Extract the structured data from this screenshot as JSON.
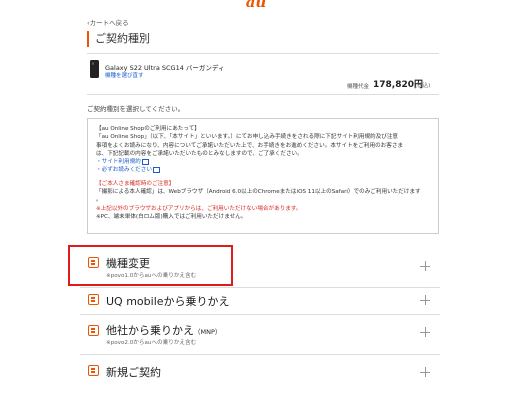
{
  "header": {
    "logo": "au"
  },
  "nav": {
    "back_label": "‹カートへ戻る"
  },
  "section": {
    "title": "ご契約種別"
  },
  "product": {
    "name": "Galaxy S22 Ultra SCG14 バーガンディ",
    "change_link": "機種を選び直す",
    "price_label": "機種代金",
    "price": "178,820円",
    "tax_note": "(税込)"
  },
  "instruction": "ご契約種別を選択してください。",
  "notice": {
    "l1": "【au Online Shopのご利用にあたって】",
    "l2": "「au Online Shop」（以下、「本サイト」といいます。）にてお申し込み手続きをされる際に下記サイト利用規約及び注意",
    "l3": "事項をよくお読みになり、内容についてご承諾いただいた上で、お手続きをお進めください。本サイトをご利用のお客さま",
    "l4": "は、下記記載の内容をご承諾いただいたものとみなしますので、ご了承ください。",
    "link1": "・サイト利用規約",
    "link2": "・必ずお読みください",
    "r1": "【ご本人さま確認時のご注意】",
    "r2a": "「撮影による本人確認」は、Webブラウザ（Android 6.0以上のChromeまたはiOS 11以上のSafari）でのみご利用いただけます",
    "r2b": "。",
    "r3": "※上記以外のブラウザおよびアプリからは、ご利用いただけない場合があります。",
    "r4": "※PC、端末単体(白ロム版)購入ではご利用いただけません。"
  },
  "options": [
    {
      "title": "機種変更",
      "title_small": "",
      "sub": "※povo1.0からauへの乗りかえ含む"
    },
    {
      "title": "UQ mobileから乗りかえ",
      "title_small": "",
      "sub": ""
    },
    {
      "title": "他社から乗りかえ",
      "title_small": "（MNP）",
      "sub": "※povo2.0からauへの乗りかえ含む"
    },
    {
      "title": "新規ご契約",
      "title_small": "",
      "sub": ""
    }
  ],
  "colors": {
    "accent": "#eb5505",
    "highlight": "#e01b1b",
    "link": "#1a5ccc",
    "warning": "#d9261c"
  }
}
